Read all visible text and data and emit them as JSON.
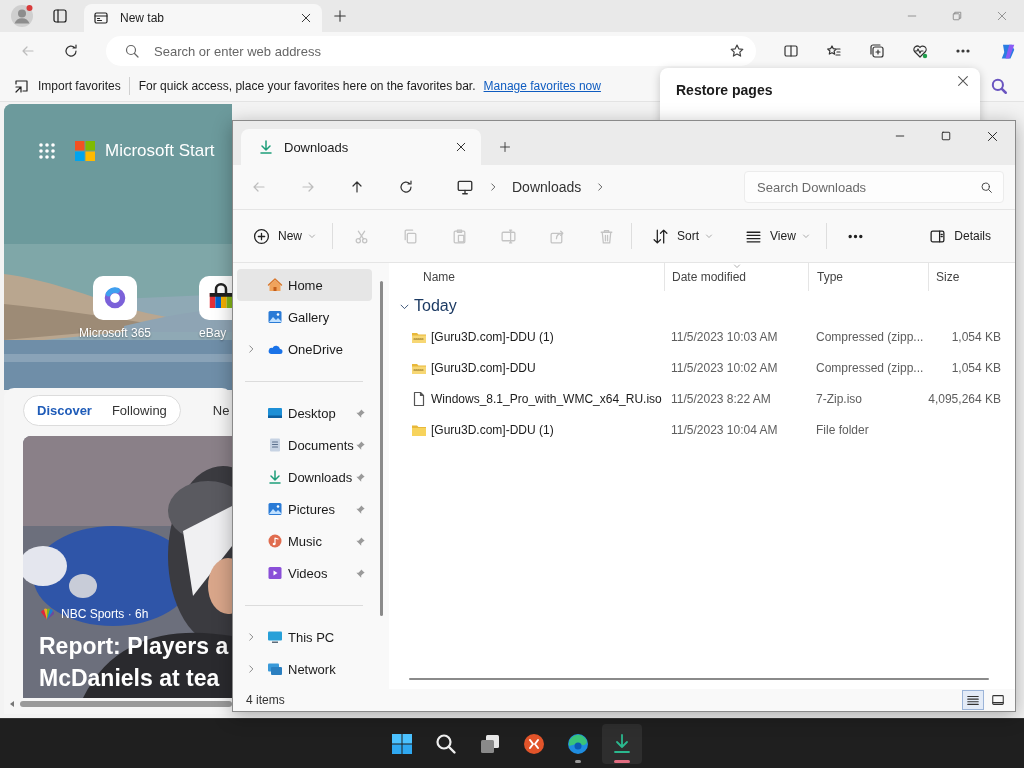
{
  "browser": {
    "tab": {
      "title": "New tab"
    },
    "back": {
      "disabled": true
    },
    "address_bar": {
      "placeholder": "Search or enter web address"
    },
    "favorites_bar": {
      "import": "Import favorites",
      "hint": "For quick access, place your favorites here on the favorites bar.",
      "link": "Manage favorites now"
    },
    "restore_popup": {
      "title": "Restore pages"
    },
    "new_tab_page": {
      "brand": "Microsoft Start",
      "shortcuts": [
        {
          "label": "Microsoft 365"
        },
        {
          "label": "eBay"
        }
      ],
      "feed_tabs": [
        {
          "label": "Discover",
          "selected": true
        },
        {
          "label": "Following",
          "selected": false
        }
      ],
      "next_tab": {
        "label": "Ne",
        "selected": false
      },
      "story": {
        "source": "NBC Sports · 6h",
        "headline_lines": [
          "Report: Players a",
          "McDaniels at tea"
        ]
      }
    }
  },
  "explorer": {
    "tab": {
      "title": "Downloads"
    },
    "nav": [
      {
        "disabled": true
      },
      {
        "disabled": true
      },
      {
        "disabled": false
      },
      {
        "disabled": false
      }
    ],
    "breadcrumb": [
      "Downloads"
    ],
    "search": {
      "placeholder": "Search Downloads"
    },
    "toolbar": [
      {
        "label": "New",
        "disabled": false,
        "menu": true
      },
      {
        "disabled": true
      },
      {
        "disabled": true
      },
      {
        "disabled": true
      },
      {
        "disabled": true
      },
      {
        "disabled": true
      },
      {
        "disabled": true
      },
      {
        "label": "Sort",
        "disabled": false,
        "menu": true
      },
      {
        "label": "View",
        "disabled": false,
        "menu": true
      },
      {
        "disabled": false
      }
    ],
    "details": "Details",
    "sidebar": [
      [
        {
          "label": "Home",
          "selected": true,
          "expandable": false,
          "pinned": false
        },
        {
          "label": "Gallery",
          "selected": false,
          "expandable": false,
          "pinned": false
        },
        {
          "label": "OneDrive",
          "selected": false,
          "expandable": true,
          "pinned": false
        }
      ],
      [
        {
          "label": "Desktop",
          "selected": false,
          "expandable": false,
          "pinned": true
        },
        {
          "label": "Documents",
          "selected": false,
          "expandable": false,
          "pinned": true
        },
        {
          "label": "Downloads",
          "selected": false,
          "expandable": false,
          "pinned": true
        },
        {
          "label": "Pictures",
          "selected": false,
          "expandable": false,
          "pinned": true
        },
        {
          "label": "Music",
          "selected": false,
          "expandable": false,
          "pinned": true
        },
        {
          "label": "Videos",
          "selected": false,
          "expandable": false,
          "pinned": true
        }
      ],
      [
        {
          "label": "This PC",
          "selected": false,
          "expandable": true,
          "pinned": false
        },
        {
          "label": "Network",
          "selected": false,
          "expandable": true,
          "pinned": false
        }
      ]
    ],
    "columns": [
      "Name",
      "Date modified",
      "Type",
      "Size"
    ],
    "group": {
      "label": "Today",
      "expanded": true
    },
    "files": [
      {
        "kind": "zip",
        "name": "[Guru3D.com]-DDU (1)",
        "date": "11/5/2023 10:03 AM",
        "type": "Compressed (zipp...",
        "size": "1,054 KB"
      },
      {
        "kind": "zip",
        "name": "[Guru3D.com]-DDU",
        "date": "11/5/2023 10:02 AM",
        "type": "Compressed (zipp...",
        "size": "1,054 KB"
      },
      {
        "kind": "file",
        "name": "Windows_8.1_Pro_with_WMC_x64_RU.iso",
        "date": "11/5/2023 8:22 AM",
        "type": "7-Zip.iso",
        "size": "4,095,264 KB"
      },
      {
        "kind": "folder",
        "name": "[Guru3D.com]-DDU (1)",
        "date": "11/5/2023 10:04 AM",
        "type": "File folder"
      }
    ],
    "status": "4 items",
    "views": [
      {
        "selected": true
      },
      {
        "selected": false
      }
    ]
  },
  "taskbar": [
    {
      "active": false,
      "running": false
    },
    {
      "active": false,
      "running": false
    },
    {
      "active": false,
      "running": false
    },
    {
      "active": false,
      "running": false
    },
    {
      "active": false,
      "running": true
    },
    {
      "active": true,
      "running": true
    }
  ]
}
